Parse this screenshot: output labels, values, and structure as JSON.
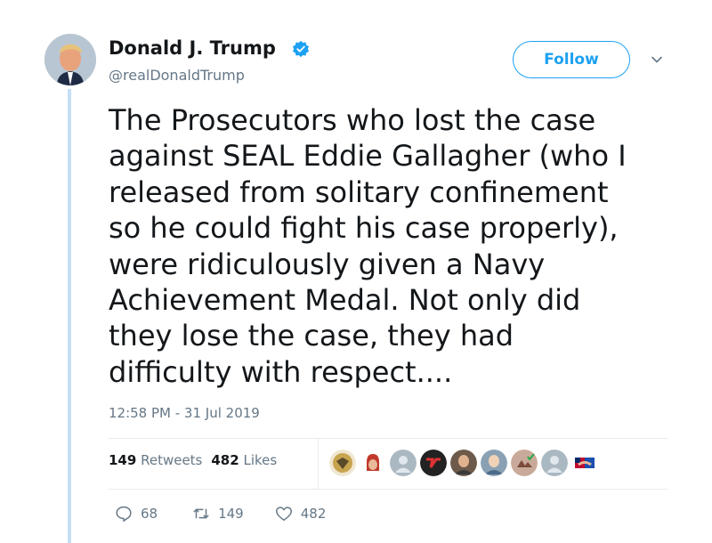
{
  "author": {
    "display_name": "Donald J. Trump",
    "handle": "@realDonaldTrump",
    "verified": true
  },
  "header": {
    "follow_label": "Follow"
  },
  "tweet": {
    "text": "The Prosecutors who lost the case\nagainst SEAL Eddie Gallagher (who I\nreleased from solitary confinement\nso he could fight his case properly),\nwere ridiculously given a Navy\nAchievement Medal. Not only did\nthey lose the case, they had\ndifficulty with respect....",
    "timestamp": "12:58 PM - 31 Jul 2019"
  },
  "stats": {
    "retweets_count": "149",
    "retweets_label": "Retweets",
    "likes_count": "482",
    "likes_label": "Likes"
  },
  "actions": {
    "replies": "68",
    "retweets": "149",
    "likes": "482"
  },
  "colors": {
    "accent": "#1da1f2",
    "secondary_text": "#657786",
    "thread_line": "#c4dff6"
  }
}
